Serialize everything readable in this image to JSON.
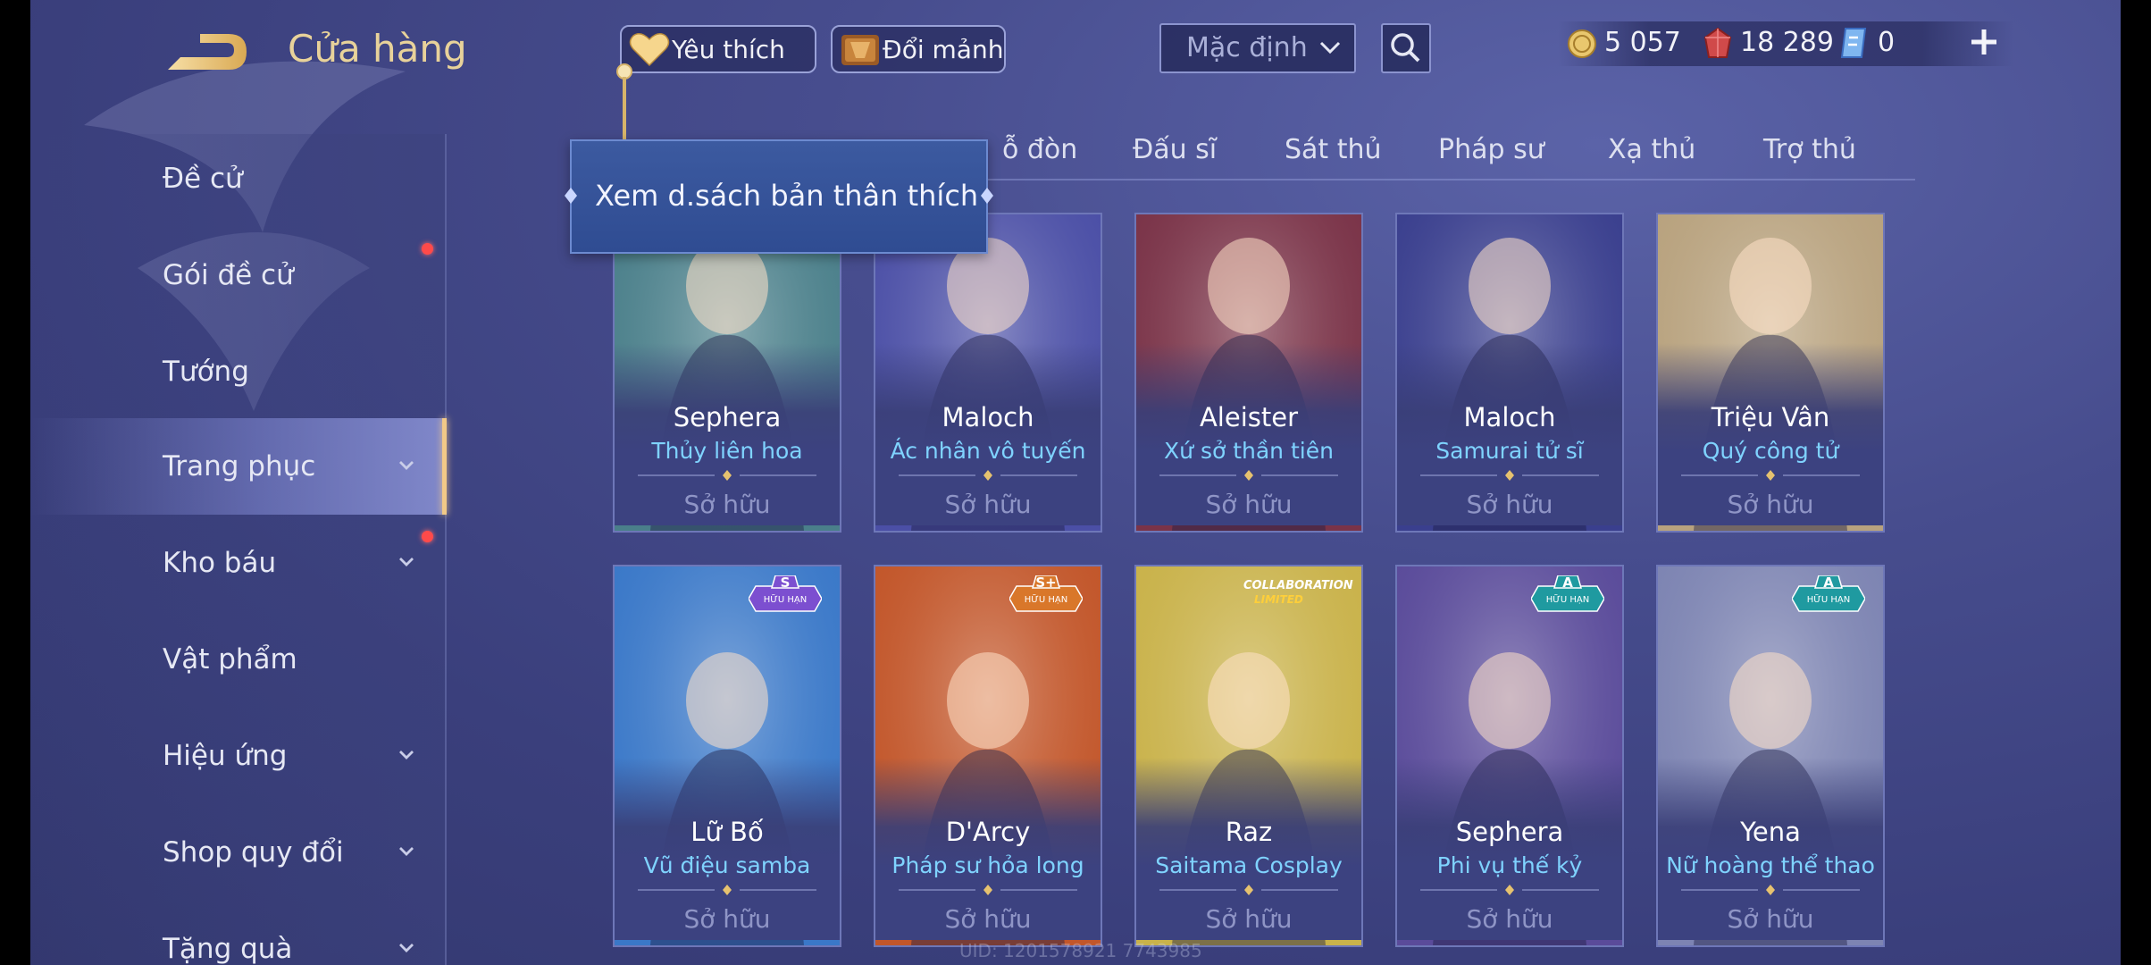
{
  "header": {
    "title": "Cửa hàng",
    "favorite_label": "Yêu thích",
    "exchange_label": "Đổi mảnh",
    "sort_value": "Mặc định"
  },
  "currency": {
    "gold": "5 057",
    "gems": "18 289",
    "vouchers": "0"
  },
  "tooltip": "Xem d.sách bản thân thích",
  "sidebar": {
    "items": [
      {
        "label": "Đề cử",
        "chevron": false,
        "dot": false,
        "active": false
      },
      {
        "label": "Gói đề cử",
        "chevron": false,
        "dot": true,
        "active": false
      },
      {
        "label": "Tướng",
        "chevron": false,
        "dot": false,
        "active": false
      },
      {
        "label": "Trang phục",
        "chevron": true,
        "dot": false,
        "active": true
      },
      {
        "label": "Kho báu",
        "chevron": true,
        "dot": true,
        "active": false
      },
      {
        "label": "Vật phẩm",
        "chevron": false,
        "dot": false,
        "active": false
      },
      {
        "label": "Hiệu ứng",
        "chevron": true,
        "dot": false,
        "active": false
      },
      {
        "label": "Shop quy đổi",
        "chevron": true,
        "dot": false,
        "active": false
      },
      {
        "label": "Tặng quà",
        "chevron": true,
        "dot": false,
        "active": false
      }
    ]
  },
  "tabs": [
    {
      "label": "ỗ đòn"
    },
    {
      "label": "Đấu sĩ"
    },
    {
      "label": "Sát thủ"
    },
    {
      "label": "Pháp sư"
    },
    {
      "label": "Xạ thủ"
    },
    {
      "label": "Trợ thủ"
    }
  ],
  "cards": [
    {
      "hero": "Sephera",
      "skin": "Thủy liên hoa",
      "status": "Sở hữu",
      "color": "#4a7f8a"
    },
    {
      "hero": "Maloch",
      "skin": "Ác nhân vô tuyến",
      "status": "Sở hữu",
      "color": "#4b4fa6"
    },
    {
      "hero": "Aleister",
      "skin": "Xứ sở thần tiên",
      "status": "Sở hữu",
      "color": "#7a3348"
    },
    {
      "hero": "Maloch",
      "skin": "Samurai tử sĩ",
      "status": "Sở hữu",
      "color": "#3a3f8e"
    },
    {
      "hero": "Triệu Vân",
      "skin": "Quý công tử",
      "status": "Sở hữu",
      "color": "#b8a27e"
    },
    {
      "hero": "Lữ Bố",
      "skin": "Vũ điệu samba",
      "status": "Sở hữu",
      "color": "#3a78c8",
      "badge": {
        "grade": "S",
        "lim": "HỮU HẠN",
        "color": "#7c4fd0"
      }
    },
    {
      "hero": "D'Arcy",
      "skin": "Pháp sư hỏa long",
      "status": "Sở hữu",
      "color": "#c2562a",
      "badge": {
        "grade": "S+",
        "lim": "HỮU HẠN",
        "color": "#d9772a"
      }
    },
    {
      "hero": "Raz",
      "skin": "Saitama Cosplay",
      "status": "Sở hữu",
      "color": "#c9b24a",
      "collab": {
        "l1": "COLLABORATION",
        "l2": "LIMITED"
      }
    },
    {
      "hero": "Sephera",
      "skin": "Phi vụ thế kỷ",
      "status": "Sở hữu",
      "color": "#5a4b9a",
      "badge": {
        "grade": "A",
        "lim": "HỮU HẠN",
        "color": "#1f9aa0"
      }
    },
    {
      "hero": "Yena",
      "skin": "Nữ hoàng thể thao",
      "status": "Sở hữu",
      "color": "#7d84b2",
      "badge": {
        "grade": "A",
        "lim": "HỮU HẠN",
        "color": "#1f9aa0"
      }
    }
  ],
  "uid": "UID: 1201578921 7743985"
}
